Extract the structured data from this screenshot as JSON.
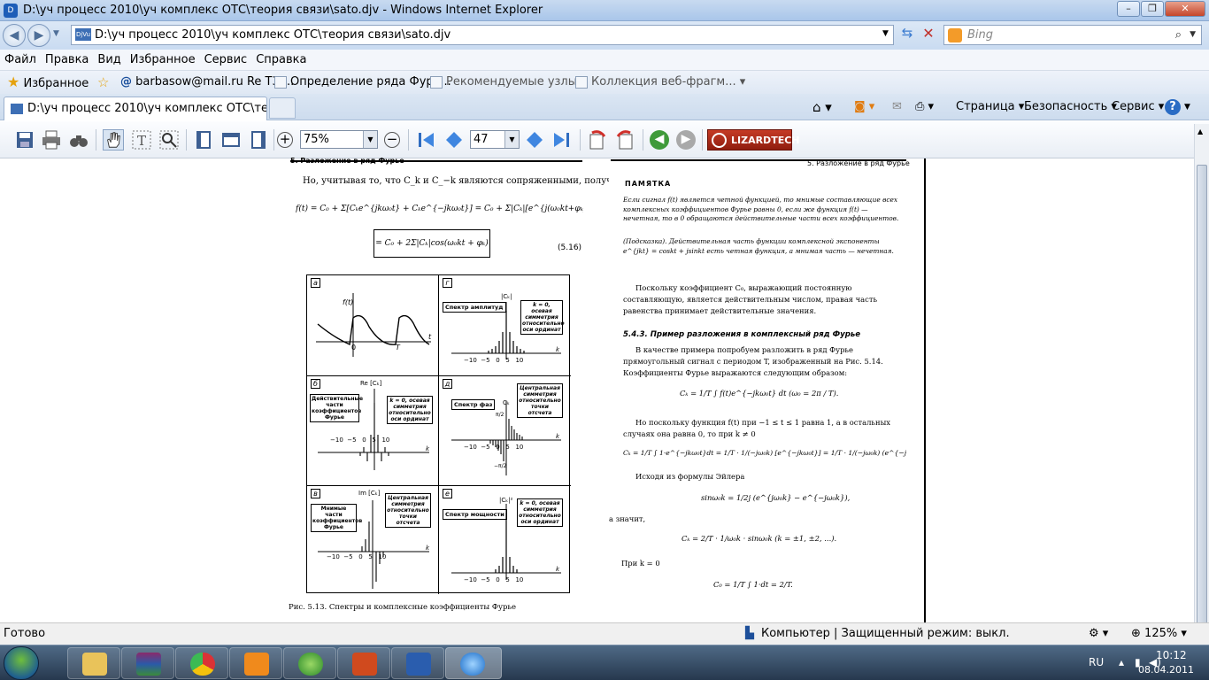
{
  "window": {
    "title": "D:\\уч процесс 2010\\уч комплекс ОТС\\теория связи\\sato.djv - Windows Internet Explorer",
    "buttons": [
      "–",
      "❐",
      "✕"
    ]
  },
  "address": {
    "url": "D:\\уч процесс 2010\\уч комплекс ОТС\\теория связи\\sato.djv",
    "djvu_badge": "DjVu"
  },
  "search": {
    "placeholder": "Bing"
  },
  "menu": [
    "Файл",
    "Правка",
    "Вид",
    "Избранное",
    "Сервис",
    "Справка"
  ],
  "favorites": {
    "label": "Избранное",
    "items": [
      "barbasow@mail.ru Re T3 ...",
      "Определение ряда Фурь...",
      "Рекомендуемые узлы ▾",
      "Коллекция веб-фрагм... ▾"
    ]
  },
  "tab": {
    "title": "D:\\уч процесс 2010\\уч комплекс ОТС\\теория с..."
  },
  "commands": {
    "page": "Страница ▾",
    "safety": "Безопасность ▾",
    "tools": "Сервис ▾"
  },
  "djvu": {
    "zoom": "75%",
    "page": "47",
    "brand": "LIZARDTECH"
  },
  "doc": {
    "header_left": "5. Разложение в ряд Фурье",
    "header_right": "5. Разложение в ряд Фурье",
    "intro": "Но, учитывая то, что C_k и C_−k являются сопряженными, получим",
    "eq1": "f(t) = C₀ + Σ[Cₖe^{jkω₀t} + C̄ₖe^{−jkω₀t}] = C₀ + Σ|Cₖ|[e^{j(ω₀kt+φₖ)} + e^{−j(ω₀kt+φₖ)}] =",
    "eq2": "= C₀ + 2Σ|Cₖ|cos(ω₀kt + φₖ)",
    "eq2_num": "(5.16)",
    "panels": {
      "a": {
        "letter": "а",
        "ylabel": "f(t)",
        "t": "t",
        "zero": "0",
        "T": "T"
      },
      "g": {
        "letter": "г",
        "title": "Спектр амплитуд",
        "ylabel": "|Cₖ|",
        "note": "k = 0, осевая симметрия относительно оси ординат",
        "ticks": "−10  −5   0   5   10",
        "k": "k"
      },
      "b": {
        "letter": "б",
        "title": "Действительные части коэффициентов Фурье",
        "ylabel": "Re [Cₖ]",
        "note": "k = 0, осевая симметрия относительно оси ординат",
        "ticks": "−10  −5   0   5   10",
        "k": "k"
      },
      "d": {
        "letter": "д",
        "title": "Спектр фаз",
        "ylabel": "Cₖ",
        "note": "Центральная симметрия относительно точки отсчета",
        "ticks": "−10  −5   0   5   10",
        "k": "k",
        "pi2": "π/2",
        "mpi2": "−π/2"
      },
      "v": {
        "letter": "в",
        "title": "Мнимые части коэффициентов Фурье",
        "ylabel": "Im [Cₖ]",
        "note": "Центральная симметрия относительно точки отсчета",
        "ticks": "−10  −5   0   5   10",
        "k": "k"
      },
      "e": {
        "letter": "е",
        "title": "Спектр мощности",
        "ylabel": "|Cₖ|²",
        "note": "k = 0, осевая симметрия относительно оси ординат",
        "ticks": "−10  −5   0   5   10",
        "k": "k"
      }
    },
    "caption": "Рис. 5.13. Спектры и комплексные коэффициенты Фурье",
    "memo_title": "ПАМЯТКА",
    "memo": "Если сигнал f(t) является четной функцией, то мнимые составляющие всех комплексных коэффициентов Фурье равны 0, если же функция f(t) — нечетная, то в 0 обращаются действительные части всех коэффициентов.",
    "hint": "(Подсказка). Действительная часть функции комплексной экспоненты e^{jkt} = coskt + jsinkt есть четная функция, а мнимая часть — нечетная.",
    "para1": "Поскольку коэффициент C₀, выражающий постоянную составляющую, является действительным числом, правая часть равенства принимает действительные значения.",
    "section": "5.4.3. Пример разложения в комплексный ряд Фурье",
    "para2": "В качестве примера попробуем разложить в ряд Фурье прямоугольный сигнал с периодом T, изображенный на Рис. 5.14. Коэффициенты Фурье выражаются следующим образом:",
    "eq3": "Cₖ = 1/T ∫ f(t)e^{−jkω₀t} dt     (ω₀ = 2π / T).",
    "para3": "Но поскольку функция f(t) при −1 ≤ t ≤ 1 равна 1, а в остальных случаях она равна 0, то при k ≠ 0",
    "eq4": "Cₖ = 1/T ∫ 1·e^{−jkω₀t}dt = 1/T · 1/(−jω₀k) [e^{−jkω₀t}] = 1/T · 1/(−jω₀k) (e^{−jω₀k} − e^{jω₀k}).",
    "para4": "Исходя из формулы Эйлера",
    "eq5": "sinω₀k = 1/2j (e^{jω₀k} − e^{−jω₀k}),",
    "para5": "а значит,",
    "eq6": "Cₖ = 2/T · 1/ω₀k · sinω₀k     (k = ±1, ±2, ...).",
    "para6": "При k = 0",
    "eq7": "C₀ = 1/T ∫ 1·dt = 2/T."
  },
  "status": {
    "ready": "Готово",
    "zone": "Компьютер | Защищенный режим: выкл.",
    "zoom": "125%"
  },
  "taskbar": {
    "lang": "RU",
    "time": "10:12",
    "date": "08.04.2011"
  }
}
